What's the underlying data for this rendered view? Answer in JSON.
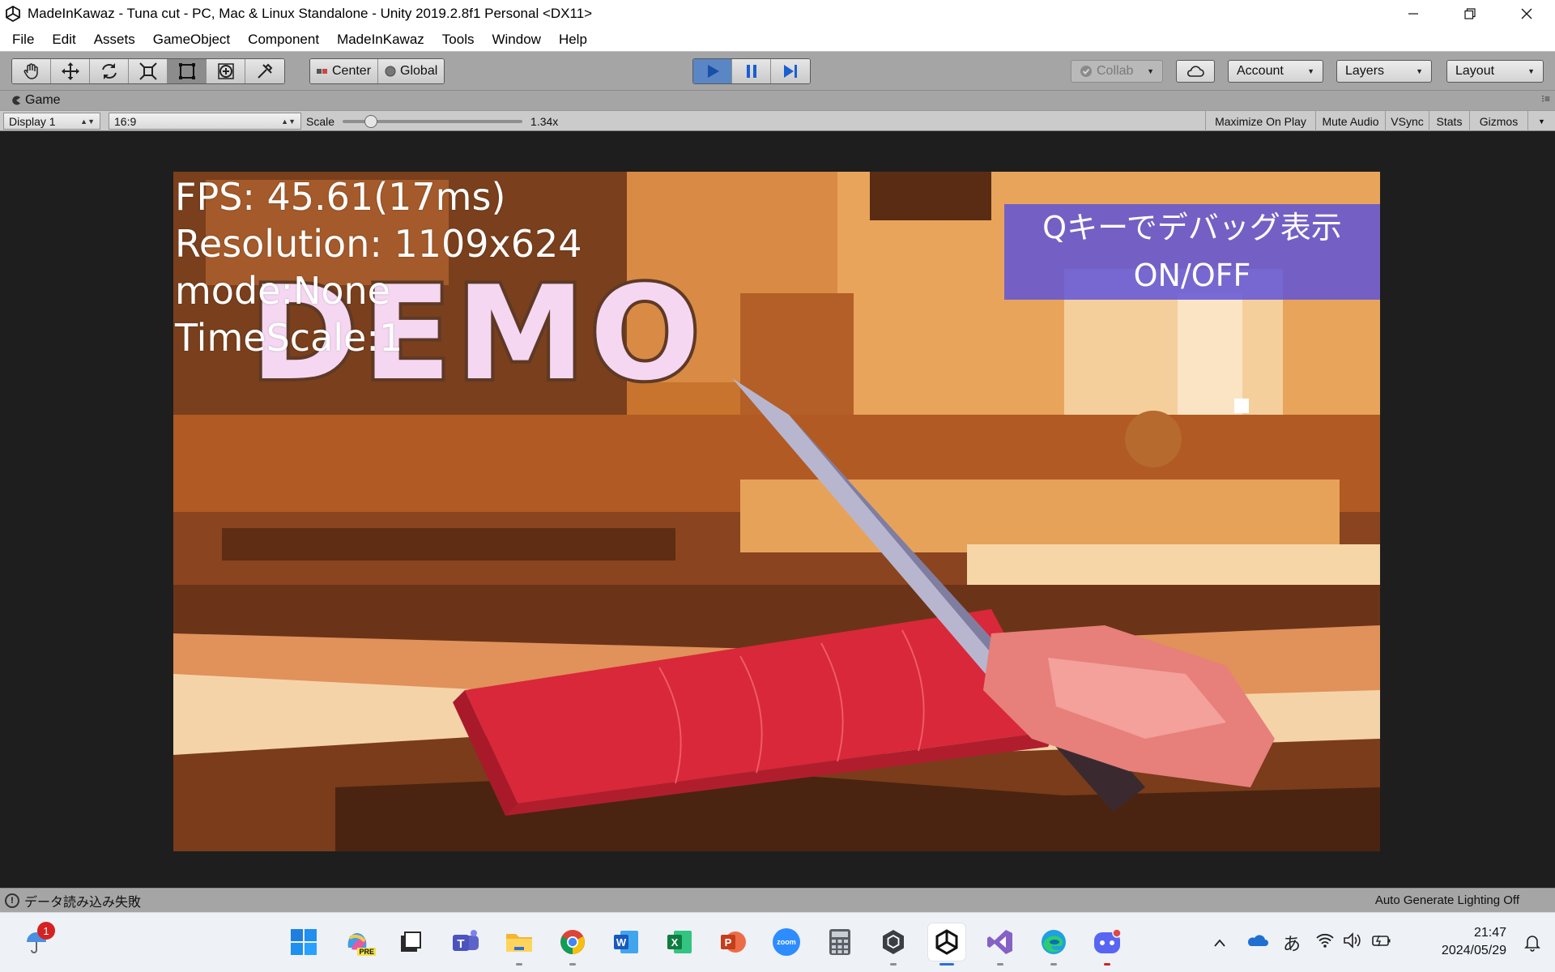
{
  "window": {
    "title": "MadeInKawaz - Tuna cut - PC, Mac & Linux Standalone - Unity 2019.2.8f1 Personal <DX11>",
    "controls": [
      "minimize-icon",
      "restore-icon",
      "close-icon"
    ]
  },
  "menu": [
    "File",
    "Edit",
    "Assets",
    "GameObject",
    "Component",
    "MadeInKawaz",
    "Tools",
    "Window",
    "Help"
  ],
  "toolbar": {
    "tools": [
      "hand-icon",
      "move-icon",
      "rotate-icon",
      "scale-icon",
      "rect-tool-icon",
      "transform-icon",
      "custom-tool-icon"
    ],
    "active_tool_index": 4,
    "pivot_label": "Center",
    "space_label": "Global",
    "collab_label": "Collab",
    "account_label": "Account",
    "layers_label": "Layers",
    "layout_label": "Layout",
    "play_state": "playing",
    "accent_color": "#5a86c6"
  },
  "game_tab": {
    "label": "Game",
    "display": "Display 1",
    "aspect": "16:9",
    "scale_label": "Scale",
    "scale_value": "1.34x",
    "scale_fraction": 0.13,
    "toggles": [
      "Maximize On Play",
      "Mute Audio",
      "VSync",
      "Stats",
      "Gizmos"
    ]
  },
  "game": {
    "fps": "FPS: 45.61(17ms)",
    "resolution": "Resolution: 1109x624",
    "mode": "mode:None",
    "timescale": "TimeScale:1",
    "watermark": "DEMO",
    "debug_line1": "Qキーでデバッグ表示",
    "debug_line2": "ON/OFF",
    "debug_banner_color": "#5a50dc"
  },
  "status": {
    "message": "データ読み込み失敗",
    "lighting": "Auto Generate Lighting Off"
  },
  "taskbar": {
    "weather_badge": "1",
    "apps": [
      "windows-start-icon",
      "copilot-icon",
      "task-view-icon",
      "teams-icon",
      "file-explorer-icon",
      "chrome-icon",
      "word-icon",
      "excel-icon",
      "powerpoint-icon",
      "zoom-icon",
      "calculator-icon",
      "unity-hub-icon",
      "unity-icon",
      "visual-studio-icon",
      "edge-icon",
      "discord-icon"
    ],
    "zoom_label": "zoom",
    "copilot_badge": "PRE",
    "ime": "あ",
    "time": "21:47",
    "date": "2024/05/29"
  }
}
